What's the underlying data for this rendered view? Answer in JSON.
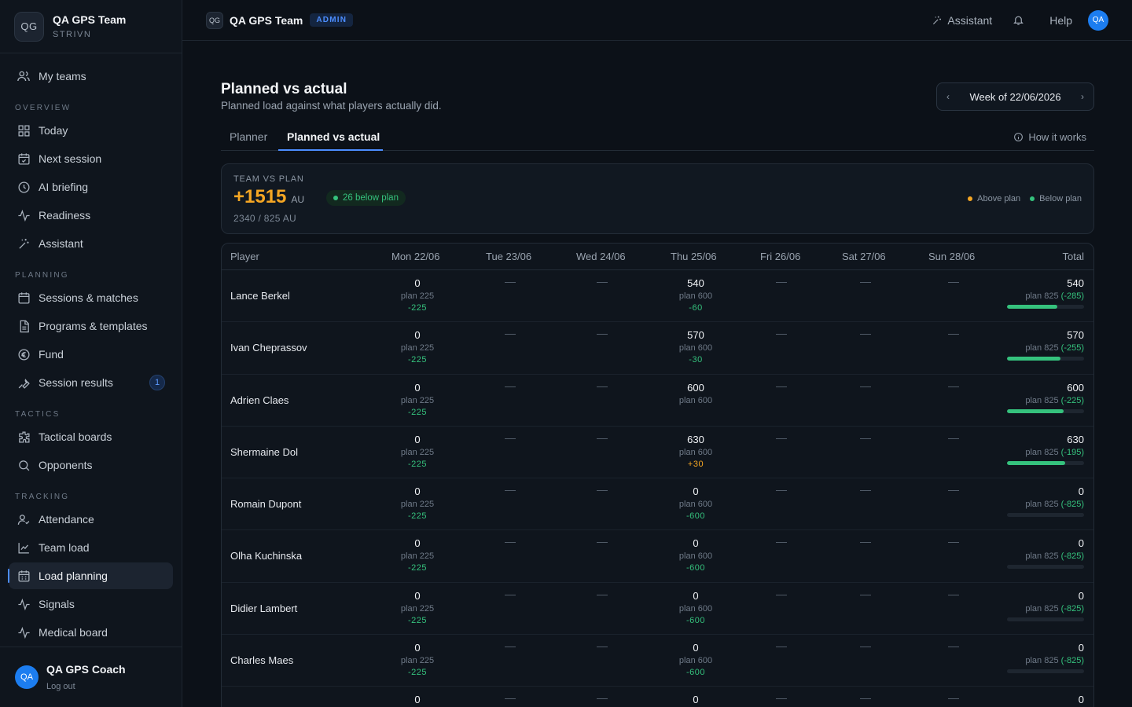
{
  "team": {
    "logo": "QG",
    "name": "QA GPS Team",
    "sub": "STRIVN"
  },
  "nav": {
    "my_teams": "My teams",
    "overview_label": "OVERVIEW",
    "today": "Today",
    "next_session": "Next session",
    "ai_briefing": "AI briefing",
    "readiness": "Readiness",
    "assistant": "Assistant",
    "planning_label": "PLANNING",
    "sessions_matches": "Sessions & matches",
    "programs_templates": "Programs & templates",
    "fund": "Fund",
    "session_results": "Session results",
    "session_results_badge": "1",
    "tactics_label": "TACTICS",
    "tactical_boards": "Tactical boards",
    "opponents": "Opponents",
    "tracking_label": "TRACKING",
    "attendance": "Attendance",
    "team_load": "Team load",
    "load_planning": "Load planning",
    "signals": "Signals",
    "medical_board": "Medical board"
  },
  "user": {
    "initials": "QA",
    "name": "QA GPS Coach",
    "logout": "Log out"
  },
  "topbar": {
    "logo": "QG",
    "team": "QA GPS Team",
    "role": "ADMIN",
    "assistant": "Assistant",
    "help": "Help",
    "avatar": "QA"
  },
  "page": {
    "title": "Planned vs actual",
    "subtitle": "Planned load against what players actually did.",
    "week": "Week of 22/06/2026",
    "tab_planner": "Planner",
    "tab_pva": "Planned vs actual",
    "how": "How it works"
  },
  "summary": {
    "label": "TEAM VS PLAN",
    "value": "+1515",
    "unit": "AU",
    "chip": "26 below plan",
    "detail": "2340 / 825 AU",
    "legend_above": "Above plan",
    "legend_below": "Below plan",
    "color_above": "#f5a623",
    "color_below": "#35c27d"
  },
  "table": {
    "headers": {
      "player": "Player",
      "mon": "Mon 22/06",
      "tue": "Tue 23/06",
      "wed": "Wed 24/06",
      "thu": "Thu 25/06",
      "fri": "Fri 26/06",
      "sat": "Sat 27/06",
      "sun": "Sun 28/06",
      "total": "Total"
    },
    "dash": "—",
    "rows": [
      {
        "name": "Lance Berkel",
        "mon_v": "0",
        "mon_p": "plan 225",
        "mon_d": "-225",
        "thu_v": "540",
        "thu_p": "plan 600",
        "thu_d": "-60",
        "thu_pos": false,
        "tot_v": "540",
        "tot_plan": "plan 825",
        "tot_d": "(-285)",
        "progress": 0.65
      },
      {
        "name": "Ivan Cheprassov",
        "mon_v": "0",
        "mon_p": "plan 225",
        "mon_d": "-225",
        "thu_v": "570",
        "thu_p": "plan 600",
        "thu_d": "-30",
        "thu_pos": false,
        "tot_v": "570",
        "tot_plan": "plan 825",
        "tot_d": "(-255)",
        "progress": 0.69
      },
      {
        "name": "Adrien Claes",
        "mon_v": "0",
        "mon_p": "plan 225",
        "mon_d": "-225",
        "thu_v": "600",
        "thu_p": "plan 600",
        "thu_d": "",
        "thu_pos": false,
        "tot_v": "600",
        "tot_plan": "plan 825",
        "tot_d": "(-225)",
        "progress": 0.73
      },
      {
        "name": "Shermaine Dol",
        "mon_v": "0",
        "mon_p": "plan 225",
        "mon_d": "-225",
        "thu_v": "630",
        "thu_p": "plan 600",
        "thu_d": "+30",
        "thu_pos": true,
        "tot_v": "630",
        "tot_plan": "plan 825",
        "tot_d": "(-195)",
        "progress": 0.76
      },
      {
        "name": "Romain Dupont",
        "mon_v": "0",
        "mon_p": "plan 225",
        "mon_d": "-225",
        "thu_v": "0",
        "thu_p": "plan 600",
        "thu_d": "-600",
        "thu_pos": false,
        "tot_v": "0",
        "tot_plan": "plan 825",
        "tot_d": "(-825)",
        "progress": 0
      },
      {
        "name": "Olha Kuchinska",
        "mon_v": "0",
        "mon_p": "plan 225",
        "mon_d": "-225",
        "thu_v": "0",
        "thu_p": "plan 600",
        "thu_d": "-600",
        "thu_pos": false,
        "tot_v": "0",
        "tot_plan": "plan 825",
        "tot_d": "(-825)",
        "progress": 0
      },
      {
        "name": "Didier Lambert",
        "mon_v": "0",
        "mon_p": "plan 225",
        "mon_d": "-225",
        "thu_v": "0",
        "thu_p": "plan 600",
        "thu_d": "-600",
        "thu_pos": false,
        "tot_v": "0",
        "tot_plan": "plan 825",
        "tot_d": "(-825)",
        "progress": 0
      },
      {
        "name": "Charles Maes",
        "mon_v": "0",
        "mon_p": "plan 225",
        "mon_d": "-225",
        "thu_v": "0",
        "thu_p": "plan 600",
        "thu_d": "-600",
        "thu_pos": false,
        "tot_v": "0",
        "tot_plan": "plan 825",
        "tot_d": "(-825)",
        "progress": 0
      },
      {
        "name": "",
        "mon_v": "0",
        "mon_p": "",
        "mon_d": "",
        "thu_v": "0",
        "thu_p": "",
        "thu_d": "",
        "thu_pos": false,
        "tot_v": "0",
        "tot_plan": "",
        "tot_d": "",
        "progress": 0
      }
    ]
  }
}
